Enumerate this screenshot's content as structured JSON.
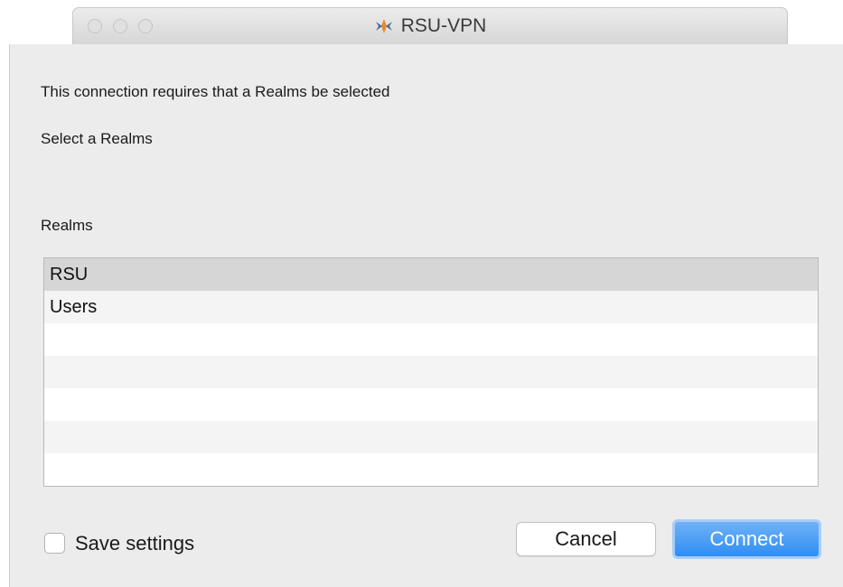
{
  "window": {
    "title": "RSU-VPN",
    "app_icon": "vpn-app-icon"
  },
  "dialog": {
    "message": "This connection requires that a Realms be selected",
    "instruction": "Select a Realms",
    "list_label": "Realms",
    "realms": [
      "RSU",
      "Users"
    ],
    "selected_realm": "RSU",
    "save_settings_label": "Save settings",
    "save_settings_checked": false
  },
  "buttons": {
    "cancel": "Cancel",
    "connect": "Connect"
  },
  "colors": {
    "window_bg": "#ececec",
    "accent": "#2f8ef3",
    "selected_row": "#d6d6d6"
  }
}
